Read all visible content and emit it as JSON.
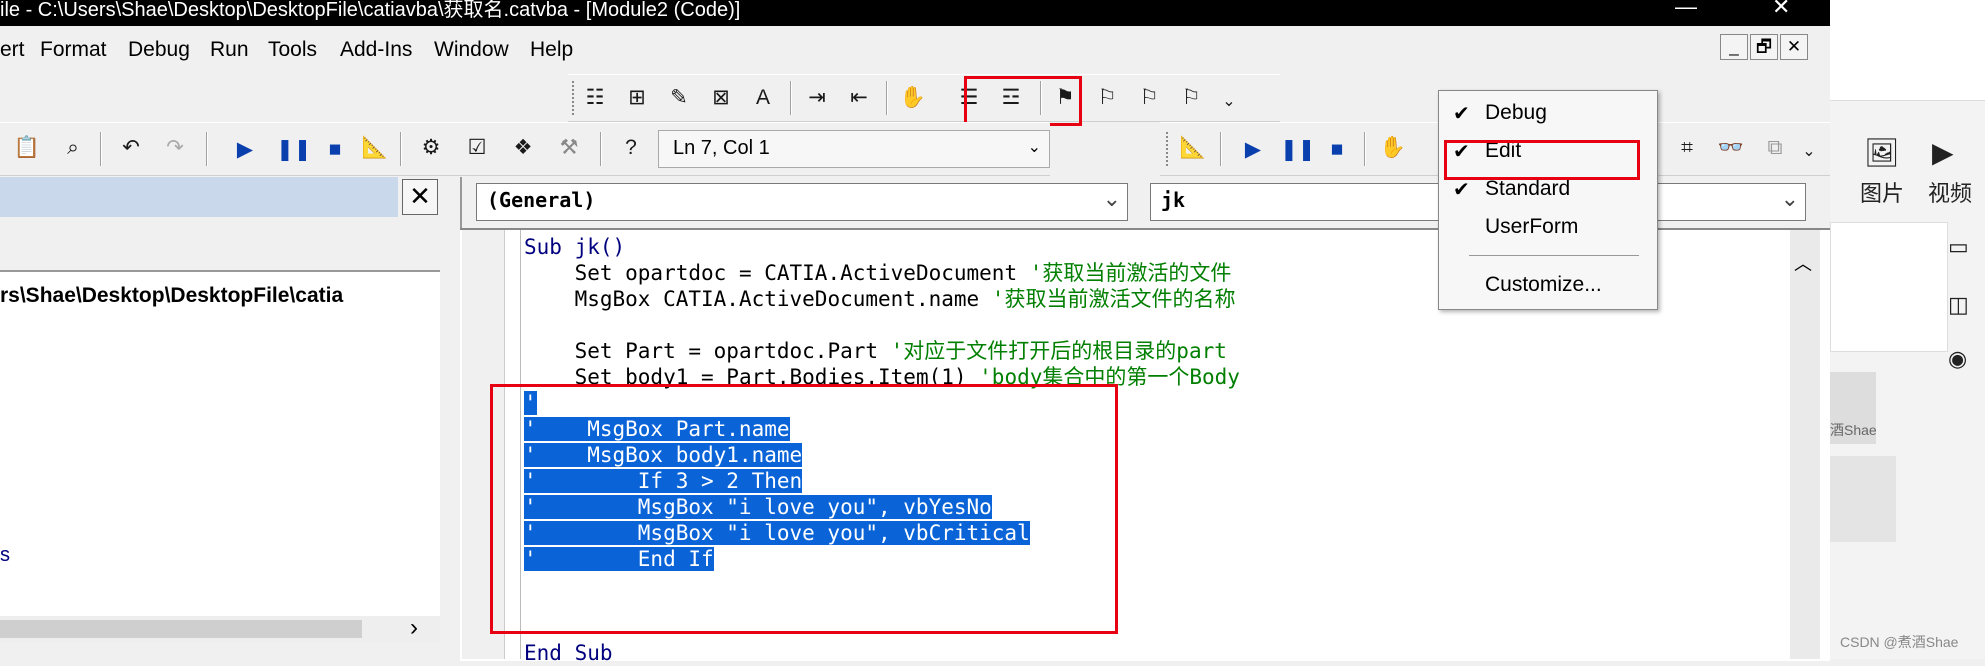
{
  "window": {
    "title": "ile - C:\\Users\\Shae\\Desktop\\DesktopFile\\catiavba\\获取名.catvba - [Module2 (Code)]",
    "min_glyph": "—",
    "close_glyph": "✕"
  },
  "menu": {
    "items": [
      {
        "label": "ert"
      },
      {
        "label": "Format"
      },
      {
        "label": "Debug"
      },
      {
        "label": "Run"
      },
      {
        "label": "Tools"
      },
      {
        "label": "Add-Ins"
      },
      {
        "label": "Window"
      },
      {
        "label": "Help"
      }
    ],
    "mdi_min": "_",
    "mdi_restore": "🗗",
    "mdi_close": "✕"
  },
  "toolbar": {
    "position_readout": "Ln 7, Col 1",
    "dropdown_arrow": "⌄"
  },
  "project_pane": {
    "close_glyph": "✕",
    "path": "rs\\Shae\\Desktop\\DesktopFile\\catia",
    "partial_item": "s",
    "scroll_right": "›"
  },
  "code_window": {
    "object_combo": "(General)",
    "proc_combo": "jk",
    "lines": [
      {
        "indent": "",
        "code": "Sub jk()",
        "comment": ""
      },
      {
        "indent": "    ",
        "code": "Set opartdoc = CATIA.ActiveDocument",
        "comment": " '获取当前激活的文件"
      },
      {
        "indent": "    ",
        "code": "MsgBox CATIA.ActiveDocument.name",
        "comment": " '获取当前激活文件的名称"
      },
      {
        "indent": "",
        "code": "",
        "comment": ""
      },
      {
        "indent": "    ",
        "code": "Set Part = opartdoc.Part",
        "comment": " '对应于文件打开后的根目录的part"
      },
      {
        "indent": "    ",
        "code": "Set body1 = Part.Bodies.Item(1)",
        "comment": " 'body集合中的第一个Body"
      }
    ],
    "selected_lines": [
      "'",
      "'    MsgBox Part.name",
      "'    MsgBox body1.name",
      "'        If 3 > 2 Then",
      "'        MsgBox \"i love you\", vbYesNo",
      "'        MsgBox \"i love you\", vbCritical",
      "'        End If"
    ],
    "last_line": "End Sub"
  },
  "context_menu": {
    "items": [
      {
        "label": "Debug",
        "checked": true
      },
      {
        "label": "Edit",
        "checked": true
      },
      {
        "label": "Standard",
        "checked": true
      },
      {
        "label": "UserForm",
        "checked": false
      },
      {
        "label": "Customize...",
        "checked": false
      }
    ],
    "check_glyph": "✔"
  },
  "right_panel": {
    "picture_label": "图片",
    "video_label": "视频",
    "watermark_small": "酒Shae",
    "footer": "CSDN @煮酒Shae"
  },
  "colors": {
    "accent_red": "#e60012",
    "selection_blue": "#0a64d8",
    "keyword": "#00007f",
    "comment": "#007f00"
  }
}
